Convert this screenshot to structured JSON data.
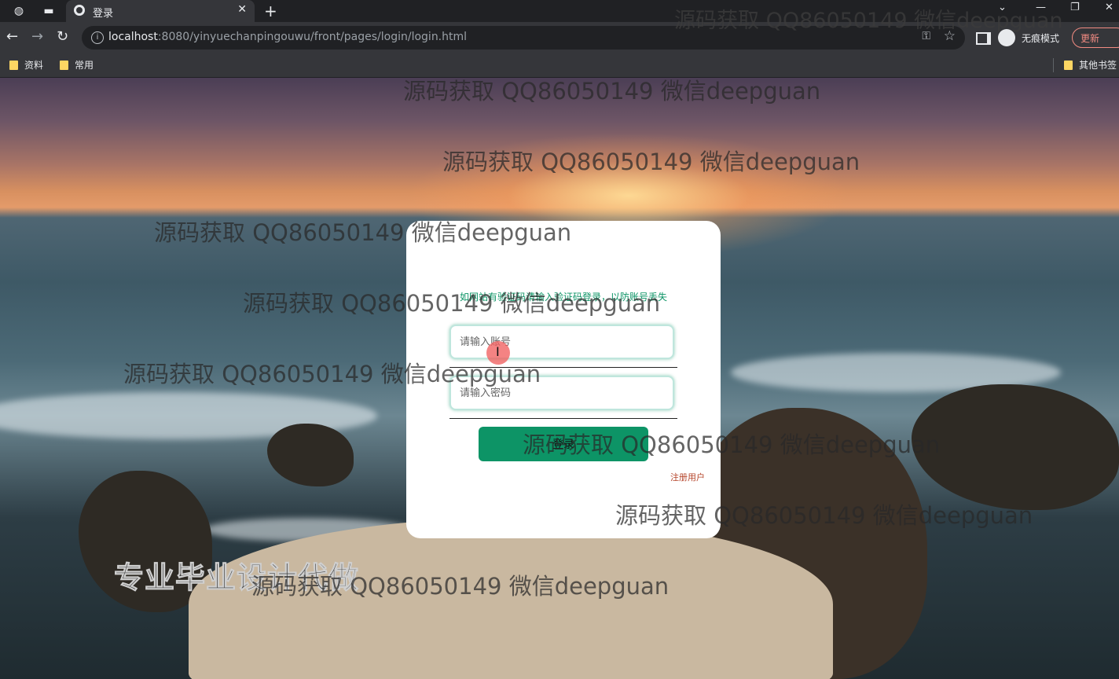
{
  "browser": {
    "tab_title": "登录",
    "new_tab": "+",
    "close_tab": "✕",
    "url_host": "localhost",
    "url_path": ":8080/yinyuechanpingouwu/front/pages/login/login.html",
    "incognito_label": "无痕模式",
    "update_label": "更新",
    "bookmarks": [
      {
        "label": "资料"
      },
      {
        "label": "常用"
      }
    ],
    "other_bookmarks": "其他书签"
  },
  "login": {
    "notice": "如网站有验证码请输入验证码登录，以防账号丢失",
    "username_placeholder": "请输入账号",
    "password_placeholder": "请输入密码",
    "login_button": "登录",
    "register_link": "注册用户"
  },
  "overlay": {
    "watermark": "源码获取 QQ86050149 微信deepguan",
    "promo": "专业毕业设计代做"
  },
  "colors": {
    "accent": "#0d9466",
    "link": "#b5442a",
    "chrome_dark": "#202124",
    "chrome_mid": "#35363a"
  }
}
